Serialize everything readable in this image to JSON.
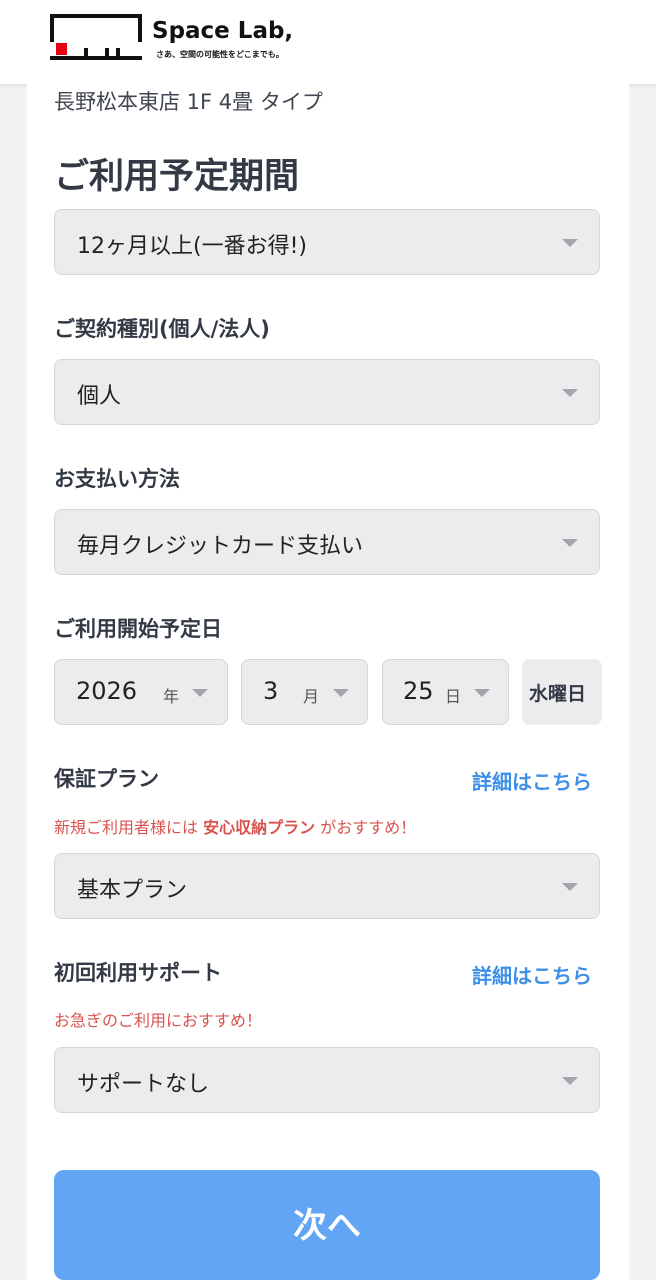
{
  "header": {
    "logo_title": "Space Lab,",
    "logo_tagline": "さあ、空間の可能性をどこまでも。"
  },
  "store": {
    "name": "長野松本東店 1F 4畳 タイプ"
  },
  "usage_period": {
    "title": "ご利用予定期間",
    "selected": "12ヶ月以上(一番お得!)"
  },
  "contract_type": {
    "label": "ご契約種別(個人/法人)",
    "selected": "個人"
  },
  "payment": {
    "label": "お支払い方法",
    "selected": "毎月クレジットカード支払い"
  },
  "start_date": {
    "label": "ご利用開始予定日",
    "year": "2026",
    "year_unit": "年",
    "month": "3",
    "month_unit": "月",
    "day": "25",
    "day_unit": "日",
    "weekday": "水曜日"
  },
  "guarantee": {
    "label": "保証プラン",
    "details_link": "詳細はこちら",
    "note_prefix": "新規ご利用者様には",
    "note_highlight": "安心収納プラン",
    "note_suffix": "がおすすめ！",
    "selected": "基本プラン"
  },
  "support": {
    "label": "初回利用サポート",
    "details_link": "詳細はこちら",
    "note": "お急ぎのご利用におすすめ！",
    "selected": "サポートなし"
  },
  "next_button": {
    "label": "次へ"
  },
  "colors": {
    "accent": "#3d8fe8",
    "button": "#62a5f5",
    "note_red": "#d9534f",
    "logo_red": "#e60012"
  }
}
